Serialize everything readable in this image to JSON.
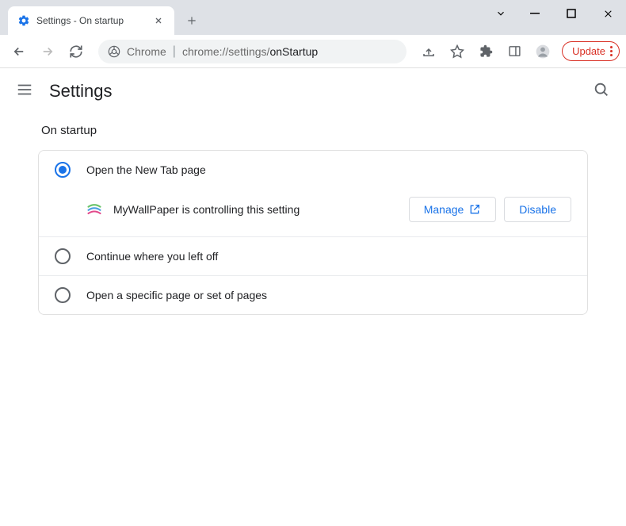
{
  "tab": {
    "title": "Settings - On startup"
  },
  "omnibox": {
    "scheme_label": "Chrome",
    "url_gray": "chrome://settings/",
    "url_dark": "onStartup"
  },
  "update_button": {
    "label": "Update"
  },
  "header": {
    "title": "Settings"
  },
  "section": {
    "title": "On startup"
  },
  "options": {
    "new_tab": "Open the New Tab page",
    "continue": "Continue where you left off",
    "specific": "Open a specific page or set of pages"
  },
  "extension": {
    "name": "MyWallPaper",
    "message": "MyWallPaper is controlling this setting",
    "manage": "Manage",
    "disable": "Disable"
  }
}
